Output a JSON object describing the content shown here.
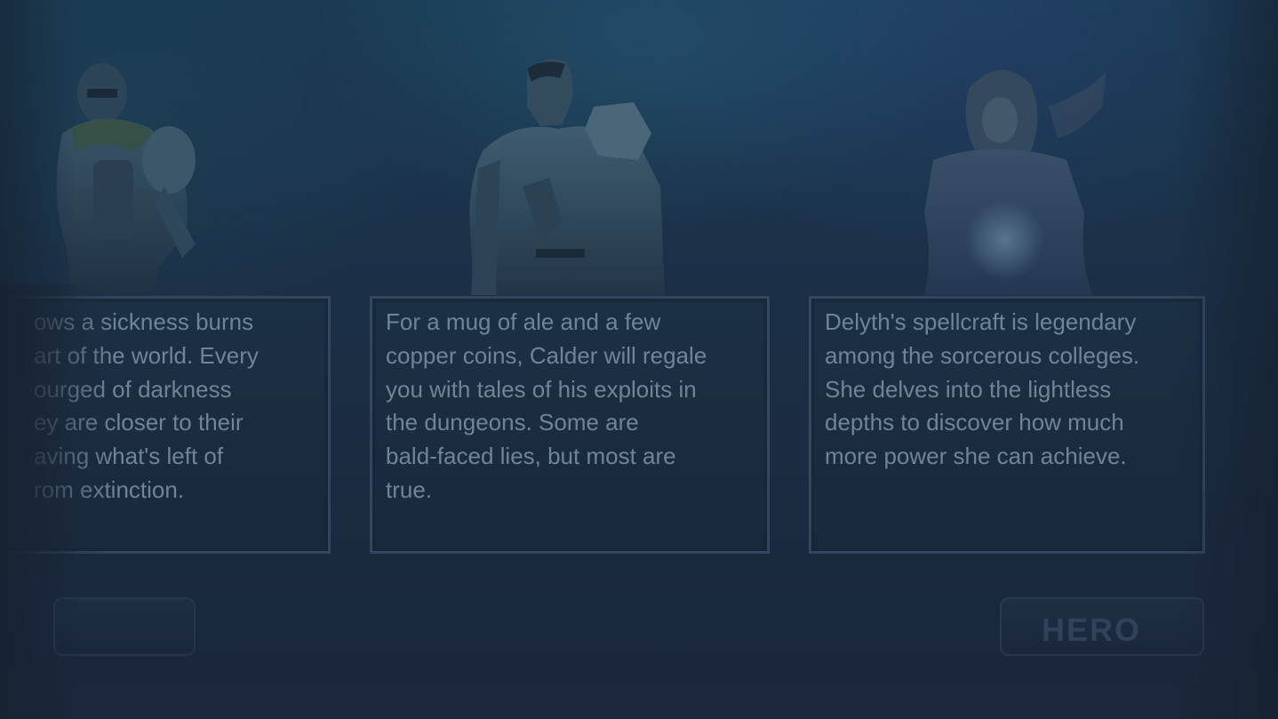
{
  "heroes": [
    {
      "name_icon": "knight-portrait",
      "description": "ows a sickness burns\nart of the world. Every\nourged of darkness\ney are closer to their\naving what's left of\nrom extinction."
    },
    {
      "name_icon": "rogue-portrait",
      "description": "For a mug of ale and a few\ncopper coins, Calder will regale\nyou with tales of his exploits in\nthe dungeons. Some are\nbald-faced lies, but most are\ntrue."
    },
    {
      "name_icon": "sorceress-portrait",
      "description": "Delyth's spellcraft is legendary\namong the sorcerous colleges.\nShe delves into the lightless\ndepths to discover how much\nmore power she can achieve."
    }
  ],
  "buttons": {
    "right_label": "HERO"
  },
  "colors": {
    "text": "#6f8596",
    "card_border": "#46607a",
    "background": "#1a2a3d"
  }
}
